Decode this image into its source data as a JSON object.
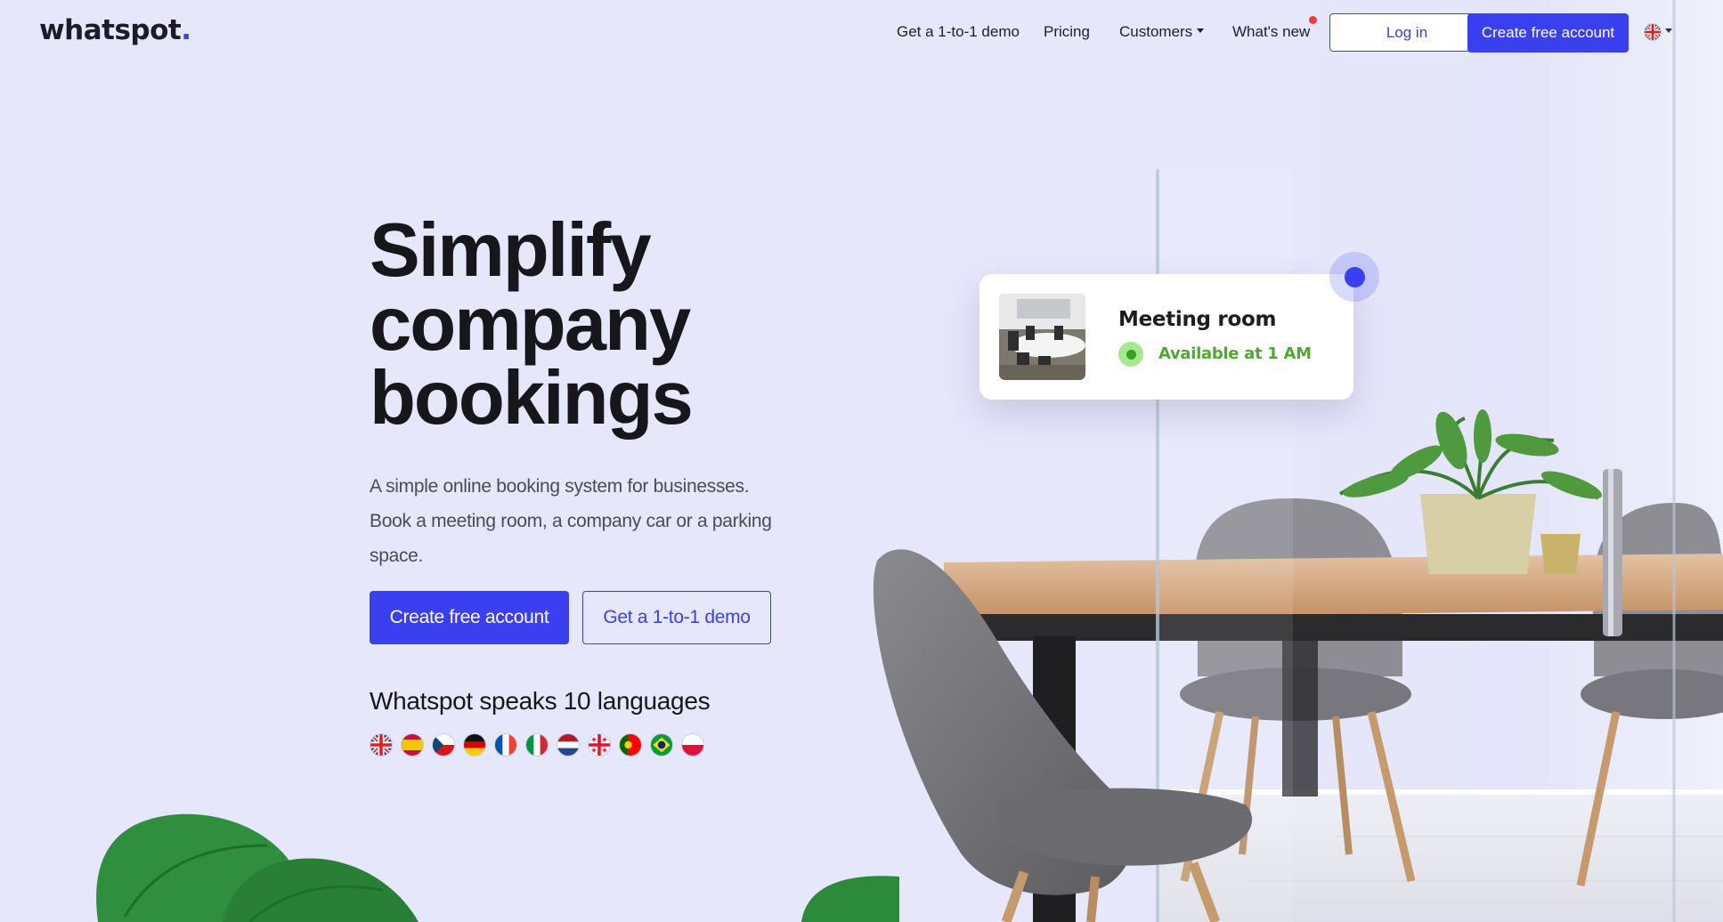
{
  "nav": {
    "logo": "whatspot",
    "logo_dot": ".",
    "links": {
      "demo": "Get a 1-to-1 demo",
      "pricing": "Pricing",
      "customers": "Customers",
      "whats_new": "What's new"
    },
    "login": "Log in",
    "create_account": "Create free account",
    "language_icon": "uk-flag-icon"
  },
  "hero": {
    "title_line1": "Simplify",
    "title_line2": "company",
    "title_line3": "bookings",
    "subtitle": "A simple online booking system for businesses. Book a meeting room, a company car or a parking space.",
    "cta_primary": "Create free account",
    "cta_secondary": "Get a 1-to-1 demo",
    "languages_heading": "Whatspot speaks 10 languages",
    "flags": [
      "uk-flag-icon",
      "spain-flag-icon",
      "czech-flag-icon",
      "germany-flag-icon",
      "france-flag-icon",
      "italy-flag-icon",
      "netherlands-flag-icon",
      "georgia-flag-icon",
      "portugal-flag-icon",
      "brazil-flag-icon",
      "poland-flag-icon"
    ]
  },
  "booking_card": {
    "title": "Meeting room",
    "status": "Available at 1 AM"
  },
  "colors": {
    "accent": "#3a40f0",
    "background": "#e6e7fb",
    "available": "#4ea832",
    "notification": "#ee3a3a"
  }
}
